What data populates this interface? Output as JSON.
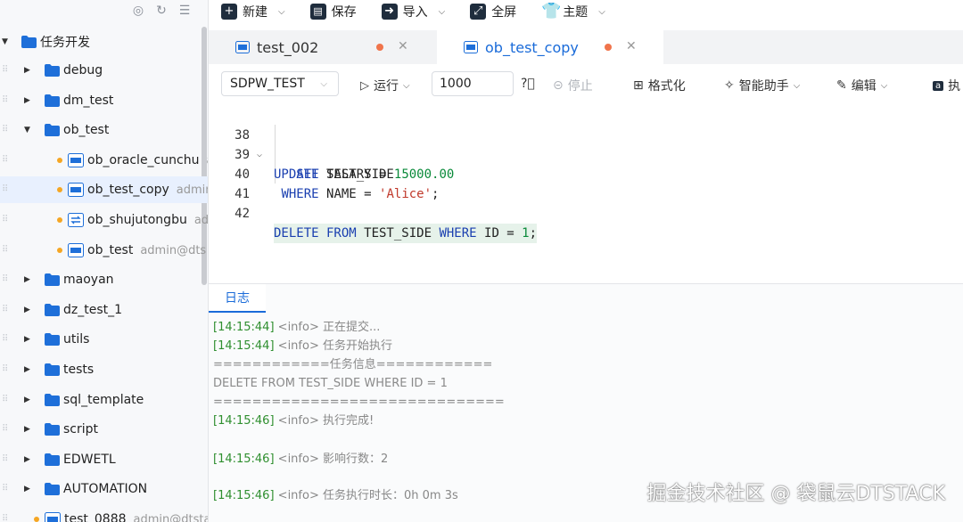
{
  "sidebar": {
    "root": "任务开发",
    "items": [
      {
        "label": "debug",
        "type": "folder"
      },
      {
        "label": "dm_test",
        "type": "folder"
      },
      {
        "label": "ob_test",
        "type": "folder",
        "expanded": true
      },
      {
        "label": "ob_oracle_cunchu",
        "owner": "a",
        "type": "file"
      },
      {
        "label": "ob_test_copy",
        "owner": "admin",
        "type": "file",
        "selected": true
      },
      {
        "label": "ob_shujutongbu",
        "owner": "ad",
        "type": "sync"
      },
      {
        "label": "ob_test",
        "owner": "admin@dts",
        "type": "file"
      },
      {
        "label": "maoyan",
        "type": "folder"
      },
      {
        "label": "dz_test_1",
        "type": "folder"
      },
      {
        "label": "utils",
        "type": "folder"
      },
      {
        "label": "tests",
        "type": "folder"
      },
      {
        "label": "sql_template",
        "type": "folder"
      },
      {
        "label": "script",
        "type": "folder"
      },
      {
        "label": "EDWETL",
        "type": "folder"
      },
      {
        "label": "AUTOMATION",
        "type": "folder"
      },
      {
        "label": "test_0888",
        "owner": "admin@dtsta",
        "type": "file"
      }
    ]
  },
  "toolbar": {
    "new": "新建",
    "save": "保存",
    "import": "导入",
    "fullscreen": "全屏",
    "theme": "主题"
  },
  "tabs": [
    {
      "label": "test_002",
      "active": false
    },
    {
      "label": "ob_test_copy",
      "active": true
    }
  ],
  "editor_toolbar": {
    "datasource": "SDPW_TEST",
    "run": "运行",
    "limit": "1000",
    "stop": "停止",
    "format": "格式化",
    "assistant": "智能助手",
    "edit": "编辑",
    "exec": "执"
  },
  "code": [
    {
      "n": "38",
      "text": "UPDATE TEST_SIDE"
    },
    {
      "n": "39",
      "text": "   SET SALARY = 15000.00"
    },
    {
      "n": "40",
      "text": " WHERE NAME = 'Alice';"
    },
    {
      "n": "41",
      "text": ""
    },
    {
      "n": "42",
      "text": "DELETE FROM TEST_SIDE WHERE ID = 1;"
    }
  ],
  "log": {
    "tab": "日志",
    "lines": [
      {
        "ts": "[14:15:44]",
        "level": "<info>",
        "msg": "正在提交..."
      },
      {
        "ts": "[14:15:44]",
        "level": "<info>",
        "msg": "任务开始执行"
      },
      {
        "plain": "============任务信息============"
      },
      {
        "plain": "DELETE FROM TEST_SIDE WHERE ID = 1"
      },
      {
        "plain": "=============================="
      },
      {
        "ts": "[14:15:46]",
        "level": "<info>",
        "msg": "执行完成!"
      },
      {
        "ts": "[14:15:46]",
        "level": "<info>",
        "msg": "影响行数：2"
      },
      {
        "ts": "[14:15:46]",
        "level": "<info>",
        "msg": "任务执行时长：0h 0m 3s"
      }
    ]
  },
  "watermark": "掘金技术社区 @ 袋鼠云DTSTACK"
}
